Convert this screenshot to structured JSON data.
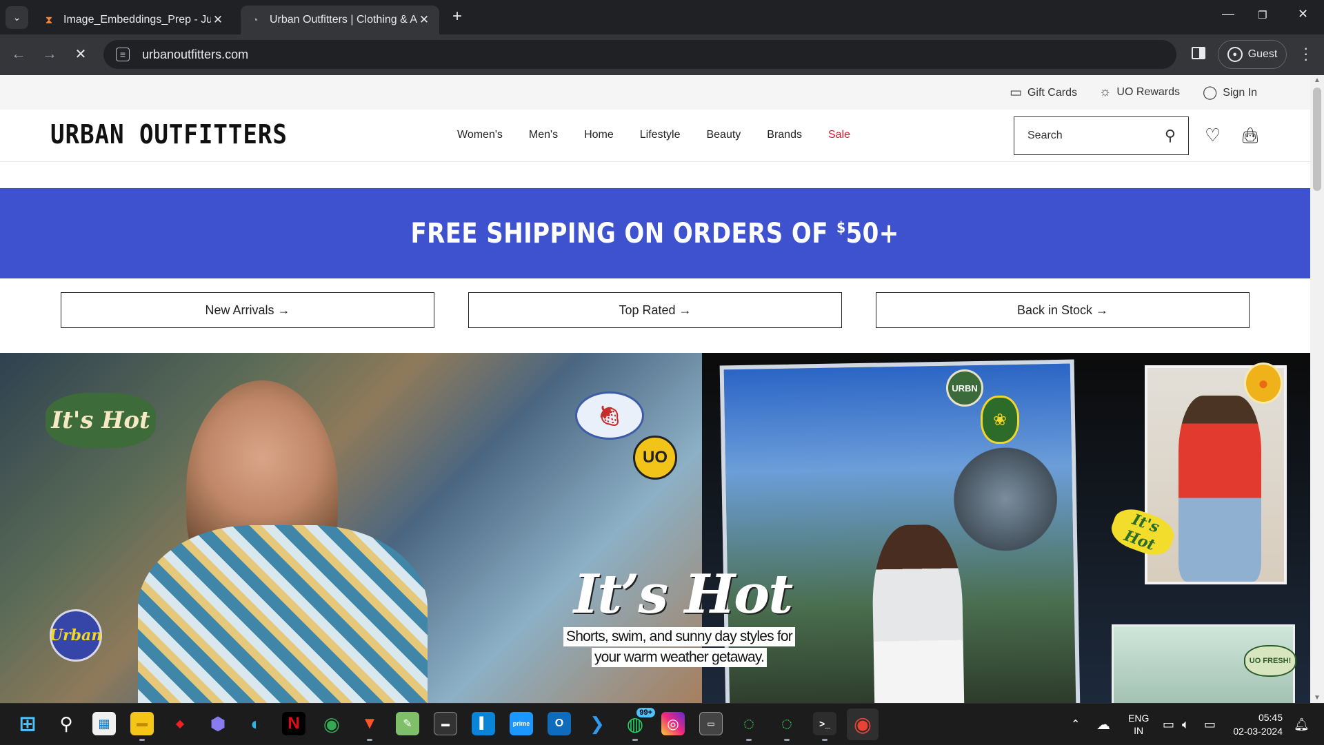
{
  "browser": {
    "tabs": [
      {
        "title": "Image_Embeddings_Prep - Jupy",
        "icon": "hourglass-icon",
        "active": false
      },
      {
        "title": "Urban Outfitters | Clothing & Ap",
        "icon": "loading-icon",
        "active": true
      }
    ],
    "url": "urbanoutfitters.com",
    "profile_label": "Guest"
  },
  "utility": {
    "gift_cards": "Gift Cards",
    "rewards": "UO Rewards",
    "sign_in": "Sign In"
  },
  "header": {
    "logo": "URBAN OUTFITTERS",
    "nav": [
      "Women's",
      "Men's",
      "Home",
      "Lifestyle",
      "Beauty",
      "Brands",
      "Sale"
    ],
    "search_placeholder": "Search"
  },
  "promo": {
    "text_before": "FREE SHIPPING ON ORDERS OF ",
    "currency": "$",
    "amount": "50+"
  },
  "quicklinks": [
    "New Arrivals →",
    "Top Rated →",
    "Back in Stock →"
  ],
  "hero": {
    "title": "It’s Hot",
    "subtitle_line1": "Shorts, swim, and sunny day styles for",
    "subtitle_line2": "your warm weather getaway.",
    "sticker_its_hot": "It's Hot",
    "sticker_uo": "UO",
    "sticker_urbn": "URBN",
    "sticker_urban": "Urban",
    "sticker_uo_fresh": "UO FRESH!"
  },
  "taskbar": {
    "apps": [
      "windows-start-icon",
      "search-icon",
      "store-icon",
      "file-explorer-icon",
      "app-red-icon",
      "app-purple-icon",
      "edge-icon",
      "netflix-icon",
      "chrome-icon",
      "brave-icon",
      "notepad-icon",
      "terminal-icon",
      "app-blue-icon",
      "prime-video-icon",
      "outlook-icon",
      "vscode-icon",
      "whatsapp-icon",
      "instagram-icon",
      "virtualbox-icon",
      "app-green-icon",
      "app-green2-icon",
      "terminal2-icon",
      "chrome-active-icon"
    ],
    "whatsapp_badge": "99+",
    "lang_top": "ENG",
    "lang_bottom": "IN",
    "time": "05:45",
    "date": "02-03-2024"
  }
}
